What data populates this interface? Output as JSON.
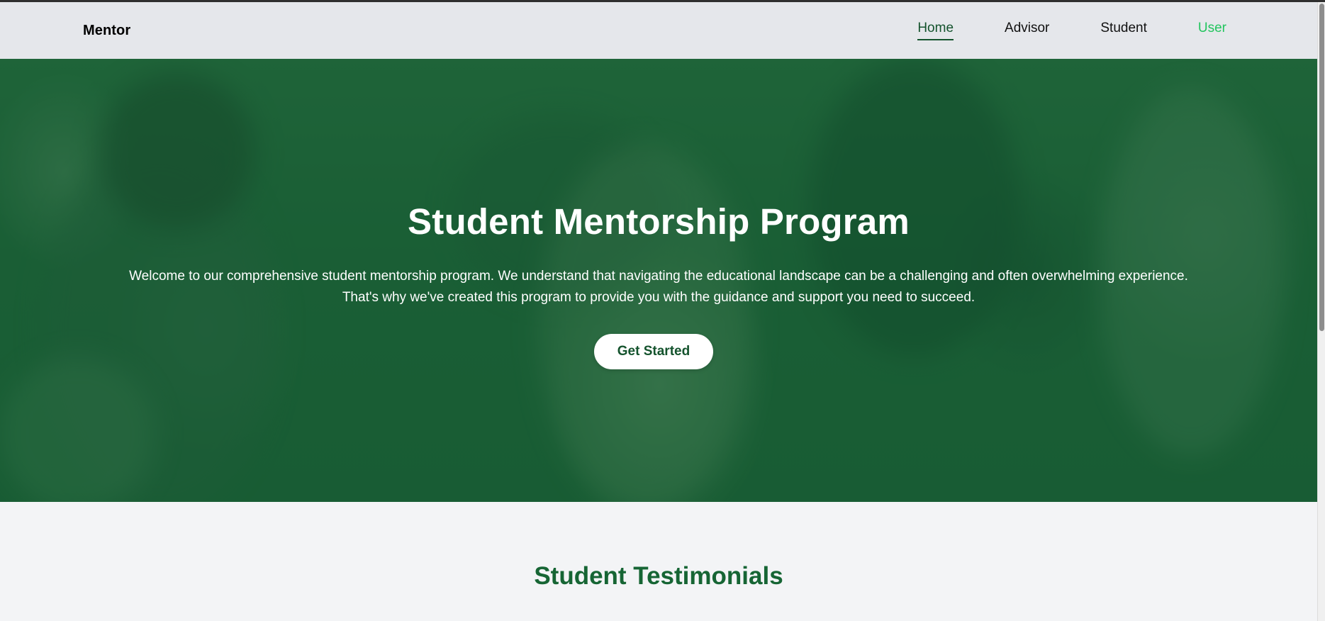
{
  "navbar": {
    "brand": "Mentor",
    "links": [
      {
        "label": "Home"
      },
      {
        "label": "Advisor"
      },
      {
        "label": "Student"
      },
      {
        "label": "User"
      }
    ]
  },
  "hero": {
    "title": "Student Mentorship Program",
    "description": "Welcome to our comprehensive student mentorship program. We understand that navigating the educational landscape can be a challenging and often overwhelming experience. That's why we've created this program to provide you with the guidance and support you need to succeed.",
    "button_label": "Get Started"
  },
  "testimonials": {
    "title": "Student Testimonials"
  },
  "colors": {
    "nav_bg": "#e5e7eb",
    "active_link": "#14532d",
    "user_link": "#22c55e",
    "hero_overlay": "#155e34",
    "section_title": "#166534",
    "page_bg": "#f3f4f6"
  }
}
